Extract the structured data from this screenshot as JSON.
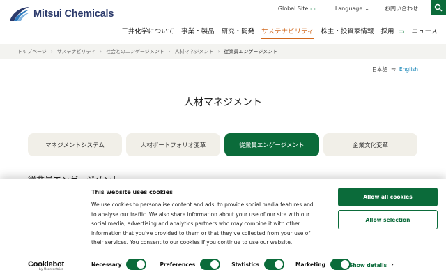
{
  "brand": {
    "logo_text": "Mitsui Chemicals"
  },
  "utility": {
    "global_site": "Global Site",
    "language": "Language",
    "contact": "お問い合わせ"
  },
  "nav": {
    "items": [
      "三井化学について",
      "事業・製品",
      "研究・開発",
      "サステナビリティ",
      "株主・投資家情報",
      "採用",
      "ニュース"
    ],
    "active_index": 3
  },
  "breadcrumb": [
    "トップページ",
    "サステナビリティ",
    "社会とのエンゲージメント",
    "人材マネジメント",
    "従業員エンゲージメント"
  ],
  "lang_switch": {
    "ja": "日本語",
    "en": "English"
  },
  "page_title": "人材マネジメント",
  "tabs": [
    "マネジメントシステム",
    "人材ポートフォリオ変革",
    "従業員エンゲージメント",
    "企業文化変革"
  ],
  "active_tab_index": 2,
  "section_heading": "従業員エンゲージメント",
  "cookie_banner": {
    "title": "This website uses cookies",
    "body": "We use cookies to personalise content and ads, to provide social media features and to analyse our traffic. We also share information about your use of our site with our social media, advertising and analytics partners who may combine it with other information that you've provided to them or that they've collected from your use of their services. You consent to our cookies if you continue to use our website.",
    "allow_all": "Allow all cookies",
    "allow_selection": "Allow selection",
    "toggles": {
      "necessary": "Necessary",
      "preferences": "Preferences",
      "statistics": "Statistics",
      "marketing": "Marketing"
    },
    "show_details": "Show details",
    "logo_main": "Cookiebot",
    "logo_sub": "by Usercentrics"
  },
  "colors": {
    "primary_green": "#0b6b3a",
    "active_nav": "#d2691e",
    "link_blue": "#0b7fb3"
  }
}
